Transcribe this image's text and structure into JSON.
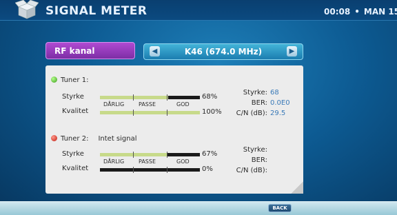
{
  "header": {
    "title": "SIGNAL METER",
    "time": "00:08",
    "separator": "•",
    "day": "MAN 15"
  },
  "channel": {
    "label": "RF kanal",
    "value": "K46 (674.0 MHz)"
  },
  "quality_scale": [
    "DÅRLIG",
    "PASSE",
    "GOD"
  ],
  "tuners": [
    {
      "name": "Tuner 1:",
      "status": "",
      "led": "green",
      "strength_label": "Styrke",
      "quality_label": "Kvalitet",
      "strength_pct": "68%",
      "strength_value": 68,
      "quality_pct": "100%",
      "quality_value": 100,
      "info_strength_label": "Styrke:",
      "info_strength": "68",
      "info_ber_label": "BER:",
      "info_ber": "0.0E0",
      "info_cn_label": "C/N (dB):",
      "info_cn": "29.5"
    },
    {
      "name": "Tuner 2:",
      "status": "Intet signal",
      "led": "red",
      "strength_label": "Styrke",
      "quality_label": "Kvalitet",
      "strength_pct": "67%",
      "strength_value": 67,
      "quality_pct": "0%",
      "quality_value": 0,
      "info_strength_label": "Styrke:",
      "info_strength": "",
      "info_ber_label": "BER:",
      "info_ber": "",
      "info_cn_label": "C/N (dB):",
      "info_cn": ""
    }
  ],
  "footer": {
    "back_label": "BACK"
  },
  "colors": {
    "accent_purple": "#9b3fc2",
    "accent_blue": "#2a93c4",
    "bar_fill": "#c7da8a",
    "led_green": "#3a9c1c",
    "led_red": "#c01a10"
  },
  "icons": {
    "app_icon": "box-icon",
    "left_arrow": "arrow-left-icon",
    "right_arrow": "arrow-right-icon"
  }
}
